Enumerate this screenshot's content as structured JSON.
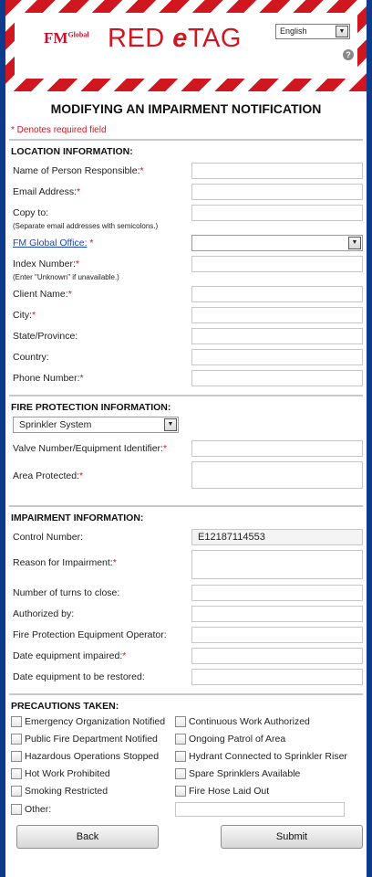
{
  "header": {
    "logo_text": "FM",
    "logo_sup": "Global",
    "brand_prefix": "RED ",
    "brand_italic": "e",
    "brand_suffix": "TAG",
    "language_value": "English",
    "language_arrow": "▼",
    "help_glyph": "?"
  },
  "page_title": "MODIFYING AN IMPAIRMENT NOTIFICATION",
  "required_note": "* Denotes required field",
  "location": {
    "title": "LOCATION INFORMATION:",
    "name_label": "Name of Person Responsible:",
    "email_label": "Email Address:",
    "copy_label": "Copy to:",
    "copy_hint": "(Separate email addresses with semicolons.)",
    "office_label": "FM Global Office:",
    "index_label": "Index Number:",
    "index_hint": "(Enter \"Unknown\" if unavailable.)",
    "client_label": "Client Name:",
    "city_label": "City:",
    "state_label": "State/Province:",
    "country_label": "Country:",
    "phone_label": "Phone Number:"
  },
  "fire": {
    "title": "FIRE PROTECTION INFORMATION:",
    "type_value": "Sprinkler System",
    "valve_label": "Valve Number/Equipment Identifier:",
    "area_label": "Area Protected:"
  },
  "impairment": {
    "title": "IMPAIRMENT INFORMATION:",
    "control_label": "Control Number:",
    "control_value": "E12187114553",
    "reason_label": "Reason for Impairment:",
    "turns_label": "Number of turns to close:",
    "authorized_label": "Authorized by:",
    "operator_label": "Fire Protection Equipment Operator:",
    "date_impaired_label": "Date equipment impaired:",
    "date_restored_label": "Date equipment to be restored:"
  },
  "precautions": {
    "title": "PRECAUTIONS TAKEN:",
    "left": [
      "Emergency Organization Notified",
      "Public Fire Department Notified",
      "Hazardous Operations Stopped",
      "Hot Work Prohibited",
      "Smoking Restricted",
      "Other:"
    ],
    "right": [
      "Continuous Work Authorized",
      "Ongoing Patrol of Area",
      "Hydrant Connected to Sprinkler Riser",
      "Spare Sprinklers Available",
      "Fire Hose Laid Out"
    ]
  },
  "buttons": {
    "back": "Back",
    "submit": "Submit"
  },
  "colors": {
    "accent_red": "#d0161e",
    "rail_blue": "#0d3a8c",
    "link_blue": "#1a44c8"
  },
  "required_mark": "*",
  "select_arrow": "▼"
}
